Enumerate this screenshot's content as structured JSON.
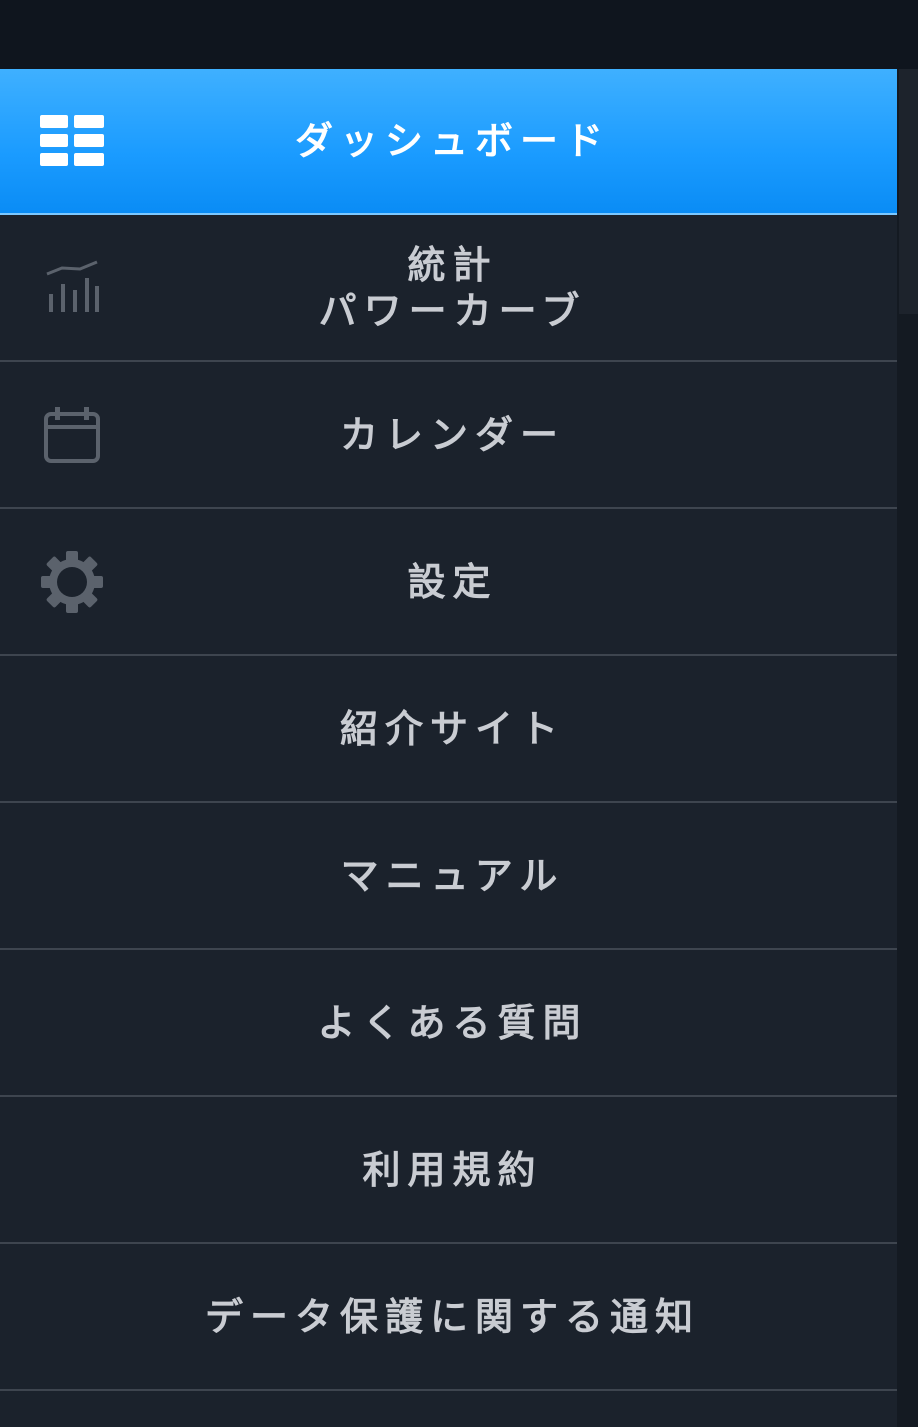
{
  "menu": {
    "items": [
      {
        "label": "ダッシュボード",
        "icon": "dashboard-icon",
        "active": true
      },
      {
        "label_line1": "統計",
        "label_line2": "パワーカーブ",
        "icon": "bar-chart-icon"
      },
      {
        "label": "カレンダー",
        "icon": "calendar-icon"
      },
      {
        "label": "設定",
        "icon": "gear-icon"
      },
      {
        "label": "紹介サイト"
      },
      {
        "label": "マニュアル"
      },
      {
        "label": "よくある質問"
      },
      {
        "label": "利用規約"
      },
      {
        "label": "データ保護に関する通知"
      }
    ]
  },
  "colors": {
    "active_background": "#1a9bff",
    "background": "#1b222c",
    "divider": "#3e454f",
    "text": "#c9ccd2",
    "icon": "#5b626c"
  }
}
